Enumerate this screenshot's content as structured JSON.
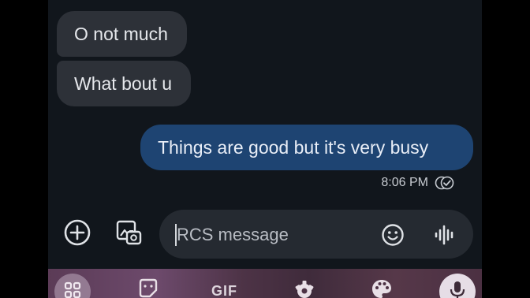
{
  "conversation": {
    "messages": [
      {
        "direction": "incoming",
        "text": "O not much"
      },
      {
        "direction": "incoming",
        "text": "What bout u"
      },
      {
        "direction": "outgoing",
        "text": "Things are good but it's very busy"
      }
    ],
    "last_status": {
      "time": "8:06 PM",
      "icon": "read-receipt-icon"
    }
  },
  "compose": {
    "placeholder": "RCS message",
    "value": "",
    "icons": [
      "add-icon",
      "gallery-icon",
      "emoji-icon",
      "voice-icon"
    ]
  },
  "keyboard": {
    "gif_label": "GIF",
    "icons": [
      "apps-grid-icon",
      "sticker-icon",
      "settings-icon",
      "palette-icon",
      "mic-icon"
    ]
  },
  "colors": {
    "background": "#11161c",
    "incoming_bubble": "#2d3138",
    "outgoing_bubble": "#1e4472",
    "input_field": "#252a31"
  }
}
